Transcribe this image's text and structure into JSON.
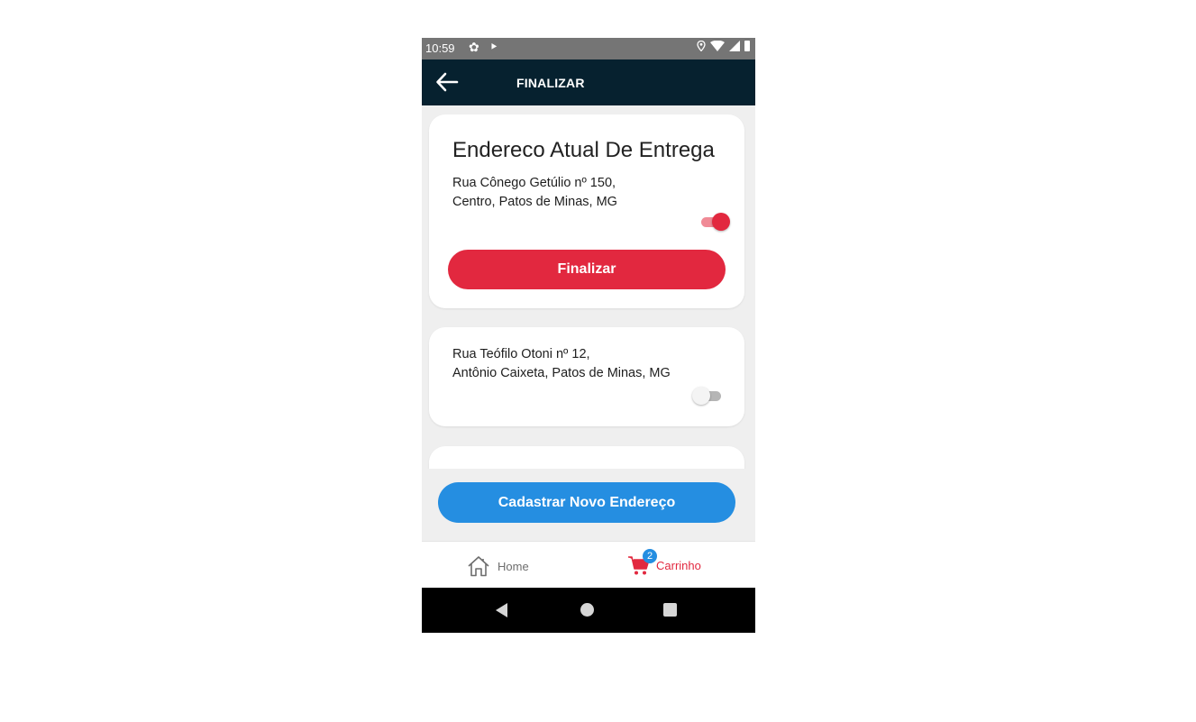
{
  "status_bar": {
    "time": "10:59",
    "icons": [
      "gear-icon",
      "play-store-icon",
      "location-icon",
      "wifi-icon",
      "signal-icon",
      "battery-icon"
    ]
  },
  "app_bar": {
    "title": "FINALIZAR",
    "back_icon": "arrow-left-icon"
  },
  "current_address_card": {
    "title": "Endereco Atual De Entrega",
    "address_line1": "Rua Cônego Getúlio nº 150,",
    "address_line2": "Centro, Patos de Minas, MG",
    "toggle_on": true,
    "finalize_label": "Finalizar"
  },
  "addresses": [
    {
      "address_line1": "Rua Teófilo Otoni nº 12,",
      "address_line2": "Antônio Caixeta, Patos de Minas, MG",
      "toggle_on": false
    }
  ],
  "new_address_button": "Cadastrar Novo Endereço",
  "bottom_nav": {
    "home_label": "Home",
    "home_icon": "home-icon",
    "cart_label": "Carrinho",
    "cart_icon": "cart-icon",
    "cart_badge": "2"
  },
  "colors": {
    "accent_red": "#e2283f",
    "accent_blue": "#258ee1",
    "app_bar": "#06212f"
  }
}
